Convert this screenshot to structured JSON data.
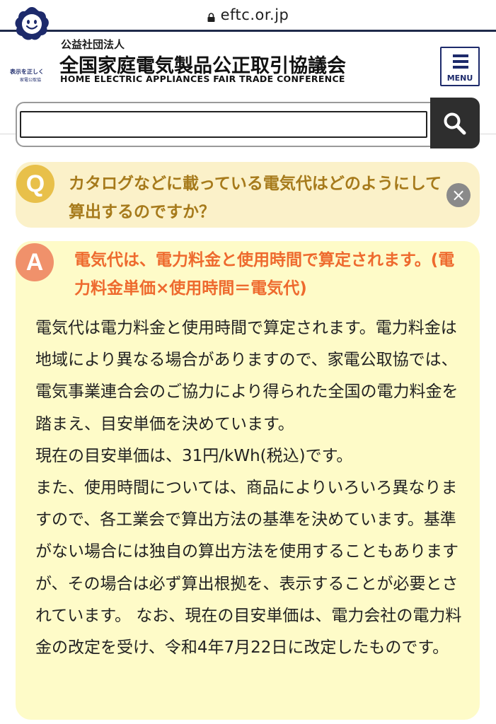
{
  "browser": {
    "url": "eftc.or.jp",
    "lock_icon": "lock-icon"
  },
  "header": {
    "logo_icon": "smiley-mascot-logo",
    "logo_caption_main": "表示を正しく",
    "logo_caption_sub": "家電公取協",
    "org_type": "公益社団法人",
    "org_name": "全国家庭電気製品公正取引協議会",
    "org_name_en": "HOME ELECTRIC APPLIANCES FAIR TRADE CONFERENCE",
    "menu_label": "MENU",
    "menu_icon": "hamburger-icon",
    "brand_color": "#1d2a6b"
  },
  "search": {
    "value": "",
    "placeholder": "",
    "button_icon": "search-icon"
  },
  "faq": {
    "question_badge": "Q",
    "question": "カタログなどに載っている電気代はどのようにして算出するのですか？",
    "close_icon": "close-icon",
    "answer_badge": "A",
    "answer_title": "電気代は、電力料金と使用時間で算定されます。(電力料金単価×使用時間＝電気代)",
    "answer_paragraphs": [
      "電気代は電力料金と使用時間で算定されます。電力料金は地域により異なる場合がありますので、家電公取協では、電気事業連合会のご協力により得られた全国の電力料金を踏まえ、目安単価を決めています。",
      "現在の目安単価は、31円/kWh(税込)です。",
      "また、使用時間については、商品によりいろいろ異なりますので、各工業会で算出方法の基準を決めています。基準がない場合には独自の算出方法を使用することもありますが、その場合は必ず算出根拠を、表示することが必要とされています。 なお、現在の目安単価は、電力会社の電力料金の改定を受け、令和4年7月22日に改定したものです。"
    ],
    "colors": {
      "question_bg": "#fbf1c9",
      "question_text": "#a67a1b",
      "question_badge": "#e8c04a",
      "answer_bg": "#fefbc8",
      "answer_title": "#ee6a2e",
      "answer_badge": "#f0916b"
    }
  }
}
